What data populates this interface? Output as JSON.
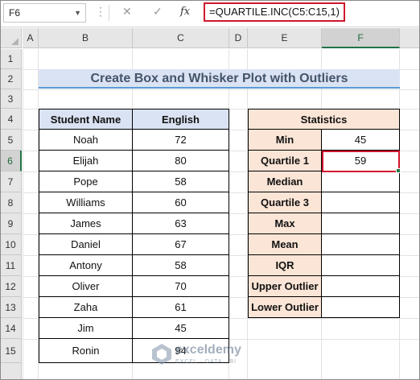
{
  "formula_bar": {
    "name_box": "F6",
    "cancel_symbol": "✕",
    "enter_symbol": "✓",
    "fx_label": "fx",
    "formula": "=QUARTILE.INC(C5:C15,1)"
  },
  "columns": [
    "A",
    "B",
    "C",
    "D",
    "E",
    "F"
  ],
  "rows": [
    "1",
    "2",
    "3",
    "4",
    "5",
    "6",
    "7",
    "8",
    "9",
    "10",
    "11",
    "12",
    "13",
    "14",
    "15"
  ],
  "selected_cell": "F6",
  "title": "Create Box and Whisker Plot with Outliers",
  "students_table": {
    "headers": [
      "Student Name",
      "English"
    ],
    "rows": [
      [
        "Noah",
        "72"
      ],
      [
        "Elijah",
        "80"
      ],
      [
        "Pope",
        "58"
      ],
      [
        "Williams",
        "60"
      ],
      [
        "James",
        "63"
      ],
      [
        "Daniel",
        "67"
      ],
      [
        "Antony",
        "58"
      ],
      [
        "Oliver",
        "70"
      ],
      [
        "Zaha",
        "61"
      ],
      [
        "Jim",
        "45"
      ],
      [
        "Ronin",
        "94"
      ]
    ]
  },
  "statistics_table": {
    "header": "Statistics",
    "rows": [
      [
        "Min",
        "45"
      ],
      [
        "Quartile 1",
        "59"
      ],
      [
        "Median",
        ""
      ],
      [
        "Quartile 3",
        ""
      ],
      [
        "Max",
        ""
      ],
      [
        "Mean",
        ""
      ],
      [
        "IQR",
        ""
      ],
      [
        "Upper Outlier",
        ""
      ],
      [
        "Lower Outlier",
        ""
      ]
    ]
  },
  "watermark": {
    "name": "exceldemy",
    "tagline": "EXCEL · DATA · BI"
  },
  "colors": {
    "title_fill": "#dae3f3",
    "title_underline": "#5b9bd5",
    "stats_header_fill": "#fbe5d6",
    "highlight_border": "#d0162e",
    "selection_green": "#217346"
  }
}
